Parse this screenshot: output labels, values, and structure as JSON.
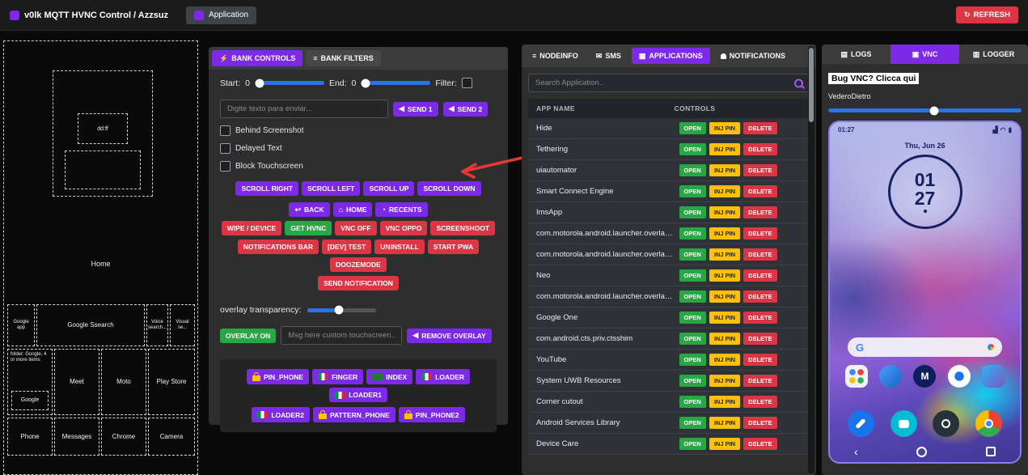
{
  "icon_glyphs": {
    "refresh": "↻",
    "bolt": "⚡",
    "list": "≡",
    "send": "◀",
    "back": "↩",
    "home": "⌂",
    "recents": "◔",
    "sms": "✉",
    "grid": "▦",
    "logs": "▤",
    "vnc": "▣",
    "logger": "▥"
  },
  "colors": {
    "accent_purple": "#7d2ae8",
    "danger_red": "#dc3545",
    "success_green": "#28a745",
    "warning_yellow": "#ffc107",
    "slider_blue": "#2a72e8"
  },
  "navbar": {
    "brand": "v0lk MQTT HVNC Control / Azzsuz",
    "application": "Application",
    "refresh": "REFRESH"
  },
  "wireframe": {
    "clock_box": "dd:ff",
    "home": "Home",
    "search_row": [
      "Google app",
      "Google Ssearch",
      "Voice search...",
      "Visual se..."
    ],
    "folder_label": "folder: Google, 4 or more items",
    "folder_inner": "Google",
    "app_row": [
      "Meet",
      "Moto",
      "Play Store"
    ],
    "dock_row": [
      "Phone",
      "Messages",
      "Chrome",
      "Camera"
    ]
  },
  "bank": {
    "tabs": [
      "BANK CONTROLS",
      "BANK FILTERS"
    ],
    "start_label": "Start:",
    "start_value": "0",
    "end_label": "End:",
    "end_value": "0",
    "filter_label": "Filter:",
    "text_input_placeholder": "Digite texto para enviar...",
    "send1": "SEND 1",
    "send2": "SEND 2",
    "checkboxes": [
      "Behind Screenshot",
      "Delayed Text",
      "Block Touchscreen"
    ],
    "scroll_buttons": [
      "SCROLL RIGHT",
      "SCROLL LEFT",
      "SCROLL UP",
      "SCROLL DOWN"
    ],
    "nav_buttons": [
      {
        "label": "BACK",
        "icon": "back"
      },
      {
        "label": "HOME",
        "icon": "home"
      },
      {
        "label": "RECENTS",
        "icon": "recents"
      }
    ],
    "action_rows": [
      [
        {
          "label": "WIPE / DEVICE",
          "style": "red"
        },
        {
          "label": "GET HVNC",
          "style": "green"
        },
        {
          "label": "VNC OFF",
          "style": "red"
        },
        {
          "label": "VNC OPPO",
          "style": "red"
        },
        {
          "label": "SCREENSHOOT",
          "style": "red"
        }
      ],
      [
        {
          "label": "NOTIFICATIONS BAR",
          "style": "red"
        },
        {
          "label": "[DEV] TEST",
          "style": "red"
        },
        {
          "label": "UNINSTALL",
          "style": "red"
        },
        {
          "label": "START PWA",
          "style": "red"
        },
        {
          "label": "DOOZEMODE",
          "style": "red"
        }
      ],
      [
        {
          "label": "SEND NOTIFICATION",
          "style": "red"
        }
      ]
    ],
    "overlay_transparency_label": "overlay transparency:",
    "overlay_on": "OVERLAY ON",
    "overlay_input_placeholder": "Msg here custom touchscreen...",
    "remove_overlay": "REMOVE OVERLAY",
    "unlock_rows": [
      [
        {
          "label": "PIN_PHONE",
          "icon": "lock"
        },
        {
          "label": "FINGER",
          "icon": "flag-it"
        },
        {
          "label": "INDEX",
          "icon": "flag-green"
        },
        {
          "label": "LOADER",
          "icon": "flag-it"
        },
        {
          "label": "LOADER1",
          "icon": "flag-it"
        }
      ],
      [
        {
          "label": "LOADER2",
          "icon": "flag-it"
        },
        {
          "label": "PATTERN_PHONE",
          "icon": "lock"
        },
        {
          "label": "PIN_PHONE2",
          "icon": "lock"
        }
      ]
    ]
  },
  "apps": {
    "tabs": [
      "NODEINFO",
      "SMS",
      "APPLICATIONS",
      "NOTIFICATIONS"
    ],
    "search_placeholder": "Search Application..",
    "columns": [
      "APP NAME",
      "CONTROLS"
    ],
    "row_buttons": [
      "OPEN",
      "INJ PIN",
      "DELETE"
    ],
    "rows": [
      "Hide",
      "Tethering",
      "uiautomator",
      "Smart Connect Engine",
      "ImsApp",
      "com.motorola.android.launcher.overlay.k...",
      "com.motorola.android.launcher.overlay.m...",
      "Neo",
      "com.motorola.android.launcher.overlay.te...",
      "Google One",
      "com.android.cts.priv.ctsshim",
      "YouTube",
      "System UWB Resources",
      "Corner cutout",
      "Android Services Library",
      "Device Care"
    ]
  },
  "vnc": {
    "tabs": [
      "LOGS",
      "VNC",
      "LOGGER"
    ],
    "bug_text": "Bug VNC? Clicca qui",
    "vedero_text": "VederoDietro",
    "phone": {
      "status_time": "01:27",
      "date": "Thu, Jun 26",
      "clock_hour": "01",
      "clock_minute": "27"
    }
  }
}
